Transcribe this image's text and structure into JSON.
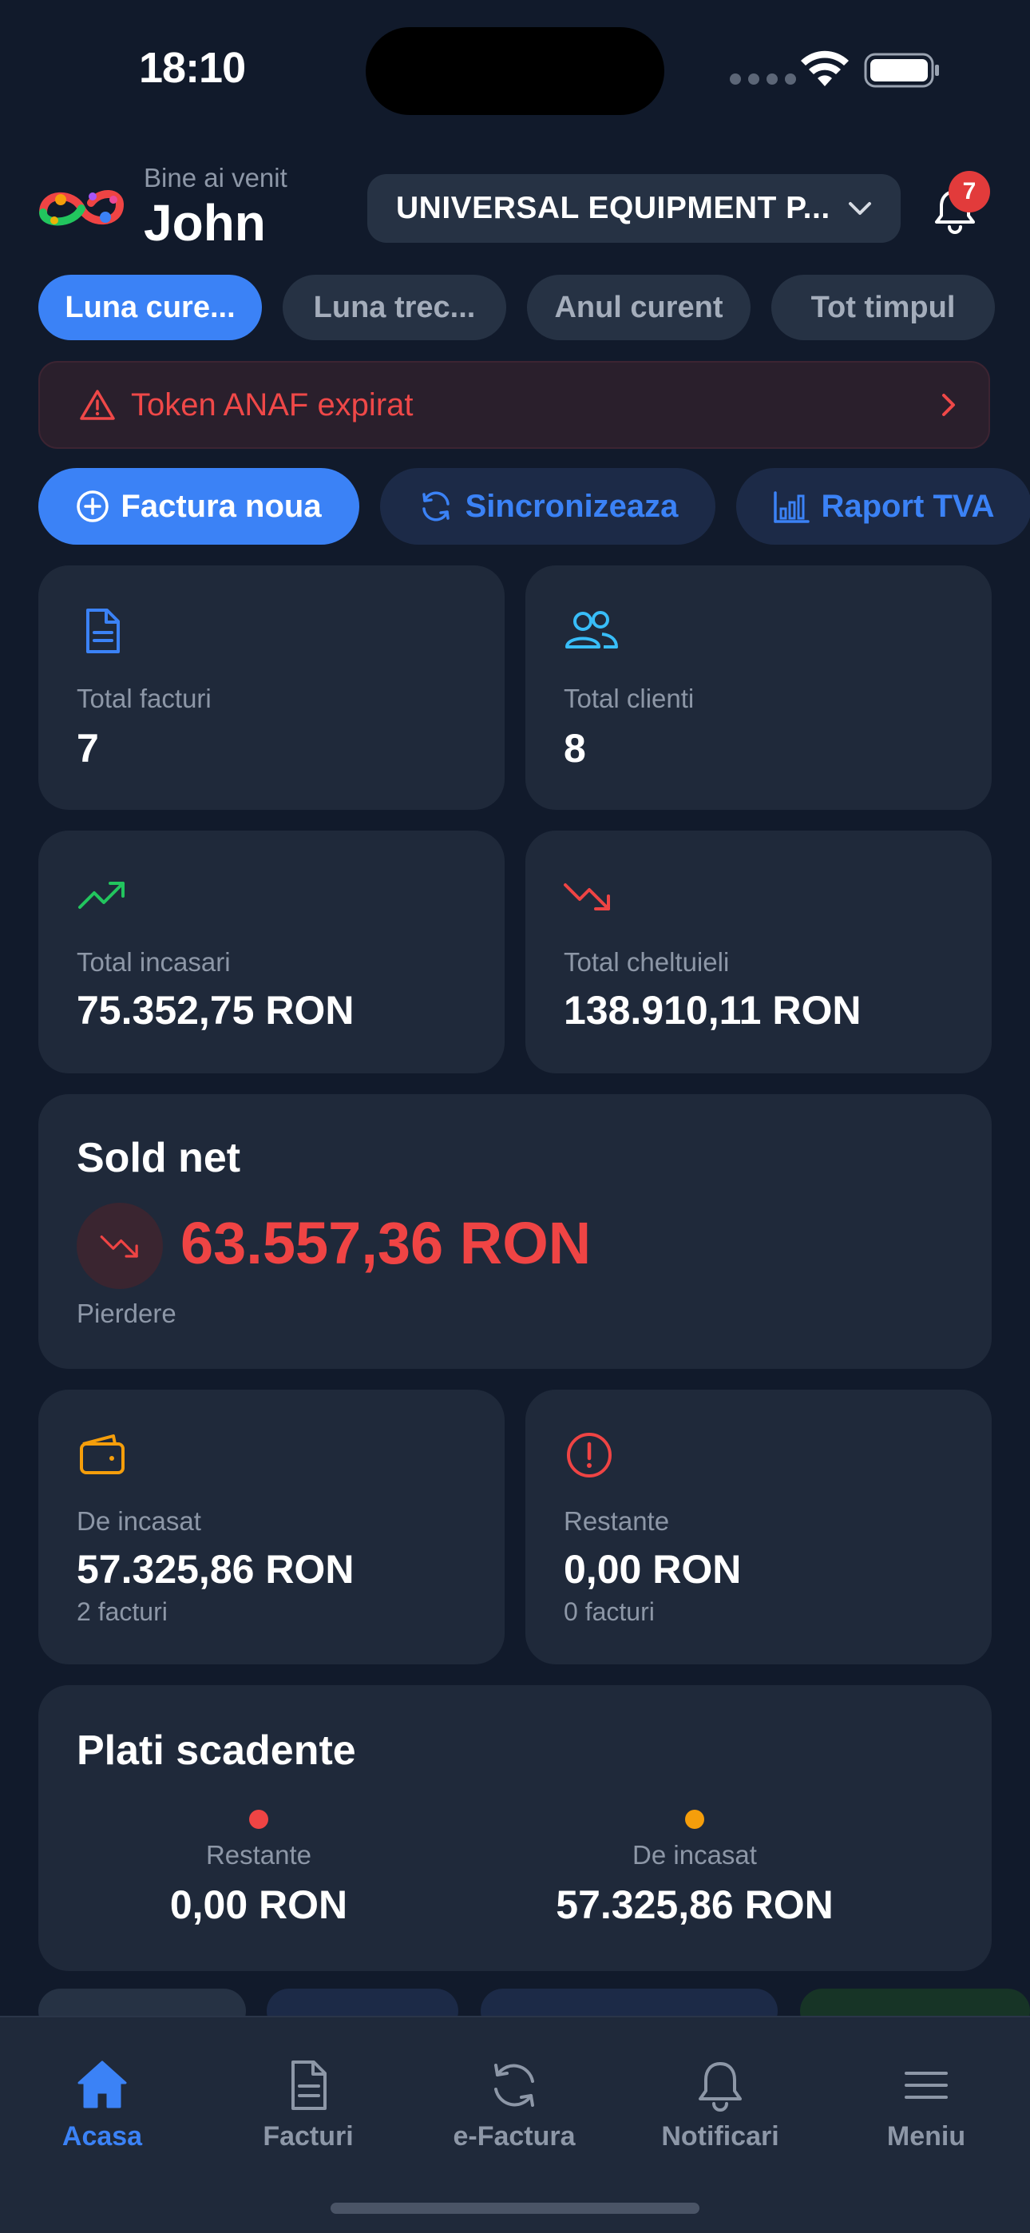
{
  "status_bar": {
    "time": "18:10"
  },
  "header": {
    "welcome": "Bine ai venit",
    "username": "John",
    "company": "UNIVERSAL EQUIPMENT P...",
    "notification_count": "7"
  },
  "period_tabs": [
    {
      "label": "Luna cure...",
      "active": true
    },
    {
      "label": "Luna trec...",
      "active": false
    },
    {
      "label": "Anul curent",
      "active": false
    },
    {
      "label": "Tot timpul",
      "active": false
    }
  ],
  "alert": {
    "text": "Token ANAF expirat"
  },
  "actions": [
    {
      "label": "Factura noua",
      "icon": "plus-circle-icon"
    },
    {
      "label": "Sincronizeaza",
      "icon": "sync-icon"
    },
    {
      "label": "Raport TVA",
      "icon": "bar-chart-icon"
    }
  ],
  "stats": {
    "total_facturi": {
      "label": "Total facturi",
      "value": "7"
    },
    "total_clienti": {
      "label": "Total clienti",
      "value": "8"
    },
    "total_incasari": {
      "label": "Total incasari",
      "value": "75.352,75 RON"
    },
    "total_cheltuieli": {
      "label": "Total cheltuieli",
      "value": "138.910,11 RON"
    }
  },
  "sold_net": {
    "title": "Sold net",
    "amount": "63.557,36 RON",
    "status": "Pierdere"
  },
  "receivables": {
    "de_incasat": {
      "label": "De incasat",
      "value": "57.325,86 RON",
      "sub": "2 facturi"
    },
    "restante": {
      "label": "Restante",
      "value": "0,00 RON",
      "sub": "0 facturi"
    }
  },
  "plati_scadente": {
    "title": "Plati scadente",
    "restante": {
      "label": "Restante",
      "value": "0,00 RON"
    },
    "de_incasat": {
      "label": "De incasat",
      "value": "57.325,86 RON"
    }
  },
  "colors": {
    "background": "#111a2b",
    "card": "#1f293a",
    "accent": "#3b82f6",
    "danger": "#ef4444",
    "success": "#22c55e",
    "warning": "#f59e0b"
  },
  "nav": [
    {
      "label": "Acasa",
      "icon": "home-icon",
      "active": true
    },
    {
      "label": "Facturi",
      "icon": "document-icon",
      "active": false
    },
    {
      "label": "e-Factura",
      "icon": "sync-icon",
      "active": false
    },
    {
      "label": "Notificari",
      "icon": "bell-icon",
      "active": false
    },
    {
      "label": "Meniu",
      "icon": "menu-icon",
      "active": false
    }
  ]
}
